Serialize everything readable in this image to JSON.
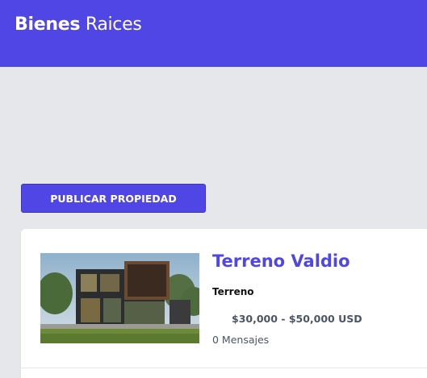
{
  "header": {
    "brand_bold": "Bienes",
    "brand_light": "Raices"
  },
  "actions": {
    "publish_label": "PUBLICAR PROPIEDAD"
  },
  "listing": {
    "title": "Terreno Valdio",
    "category": "Terreno",
    "price": "$30,000 - $50,000 USD",
    "messages": "0 Mensajes"
  },
  "colors": {
    "brand": "#4f46e5",
    "page_background": "#e5e7eb",
    "card_background": "#ffffff"
  }
}
